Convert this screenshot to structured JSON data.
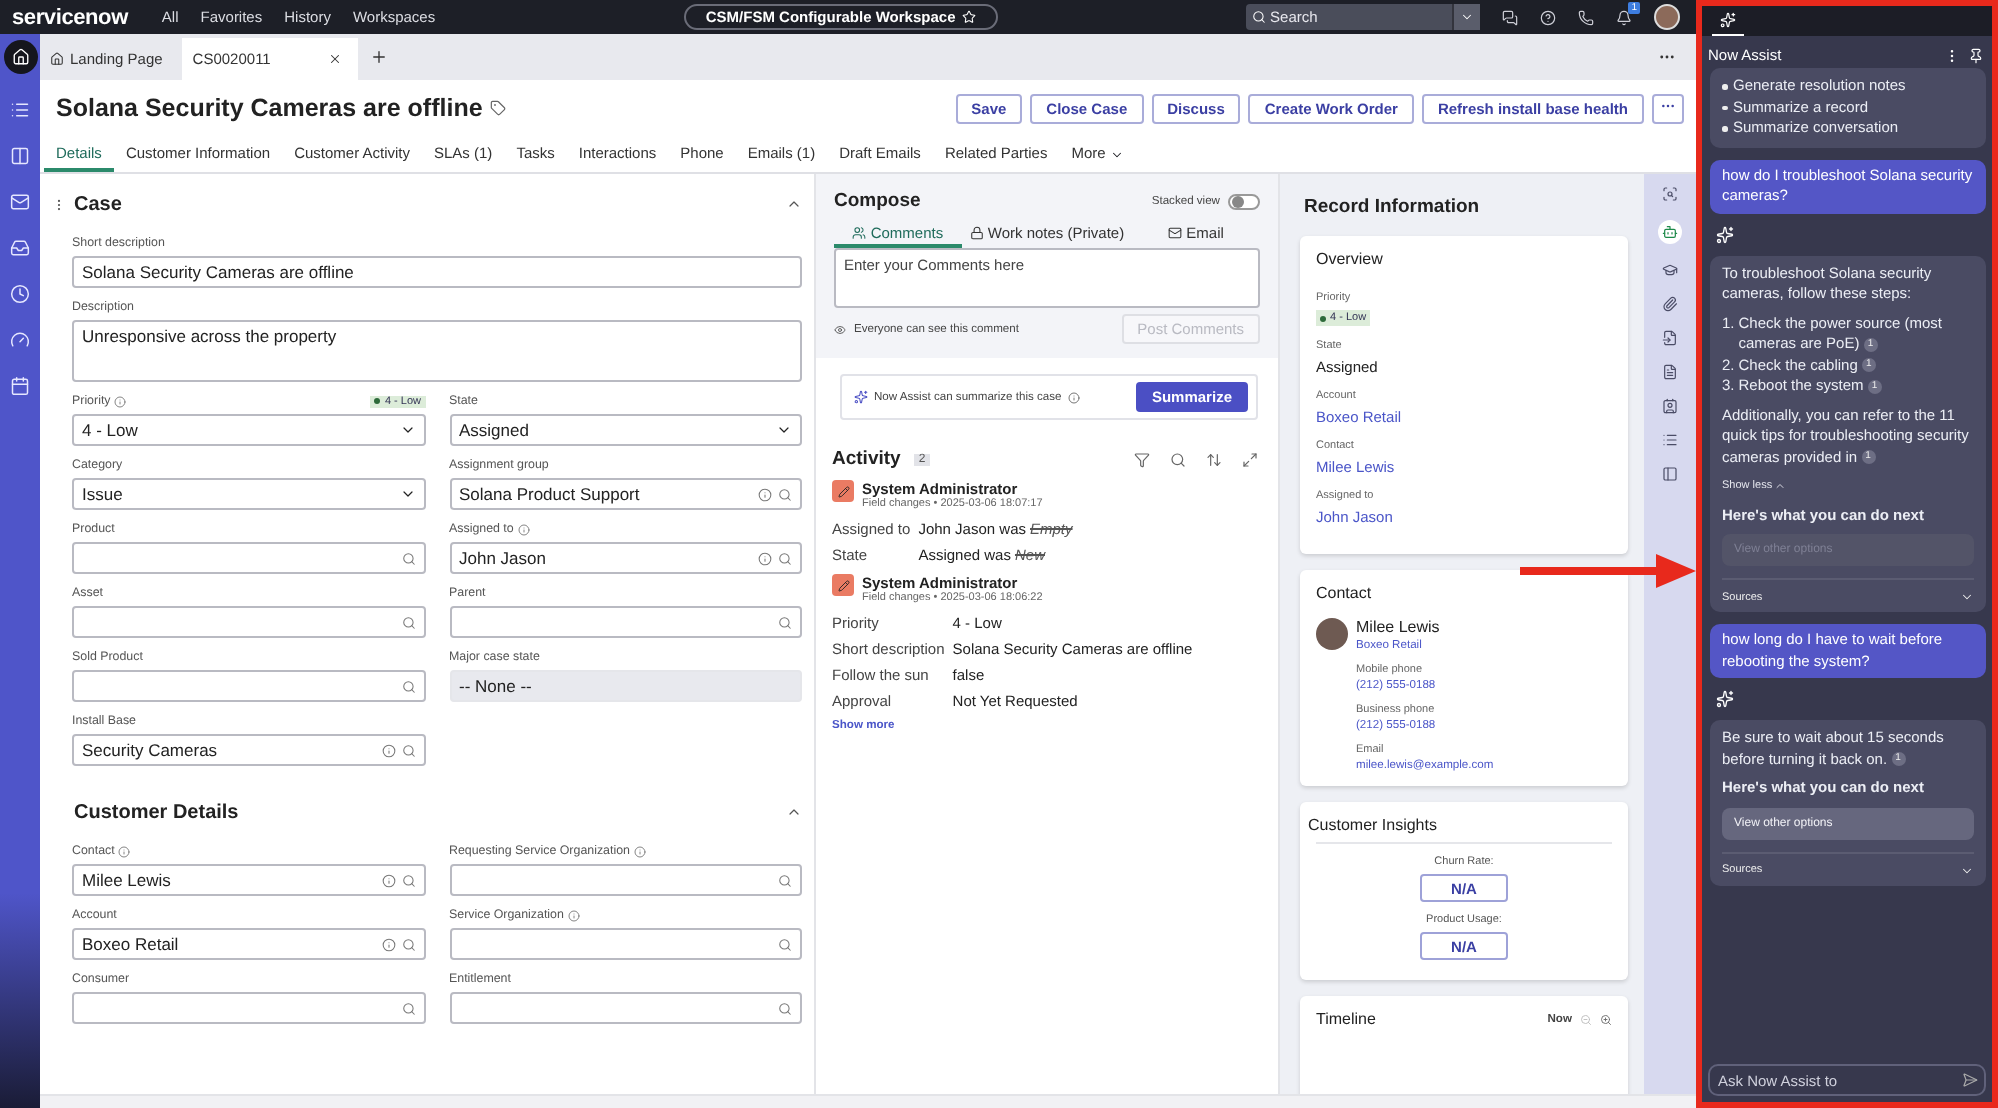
{
  "top_bar": {
    "logo": "servicenow",
    "nav": [
      "All",
      "Favorites",
      "History",
      "Workspaces"
    ],
    "workspace": "CSM/FSM Configurable Workspace",
    "search": {
      "placeholder": "Search"
    },
    "notification_count": "1"
  },
  "tabs": [
    {
      "label": "Landing Page",
      "kind": "home",
      "selected": false
    },
    {
      "label": "CS0020011",
      "kind": "record",
      "selected": true
    }
  ],
  "record": {
    "title": "Solana Security Cameras are offline",
    "actions": [
      "Save",
      "Close Case",
      "Discuss",
      "Create Work Order",
      "Refresh install base health"
    ]
  },
  "record_tabs": [
    {
      "label": "Details",
      "selected": true
    },
    {
      "label": "Customer Information",
      "selected": false
    },
    {
      "label": "Customer Activity",
      "selected": false
    },
    {
      "label": "SLAs (1)",
      "selected": false
    },
    {
      "label": "Tasks",
      "selected": false
    },
    {
      "label": "Interactions",
      "selected": false
    },
    {
      "label": "Phone",
      "selected": false
    },
    {
      "label": "Emails (1)",
      "selected": false
    },
    {
      "label": "Draft Emails",
      "selected": false
    },
    {
      "label": "Related Parties",
      "selected": false
    },
    {
      "label": "More",
      "selected": false,
      "kind": "menu"
    }
  ],
  "sections": [
    {
      "title": "Case",
      "expanded": true,
      "fields": [
        {
          "label": "Short description",
          "kind": "text",
          "value": "Solana Security Cameras are offline"
        },
        {
          "label": "Description",
          "kind": "textarea",
          "value": "Unresponsive across the property"
        },
        {
          "label": "Priority",
          "kind": "select",
          "value": "4 - Low",
          "info": true,
          "badge": "4 - Low"
        },
        {
          "label": "State",
          "kind": "select",
          "value": "Assigned"
        },
        {
          "label": "Category",
          "kind": "select",
          "value": "Issue"
        },
        {
          "label": "Assignment group",
          "kind": "lookup",
          "value": "Solana Product Support",
          "preview": true
        },
        {
          "label": "Product",
          "kind": "lookup"
        },
        {
          "label": "Assigned to",
          "kind": "lookup",
          "value": "John Jason",
          "info": true,
          "preview": true
        },
        {
          "label": "Asset",
          "kind": "lookup"
        },
        {
          "label": "Parent",
          "kind": "lookup"
        },
        {
          "label": "Sold Product",
          "kind": "lookup"
        },
        {
          "label": "Major case state",
          "kind": "readonly",
          "value": "-- None --"
        },
        {
          "label": "Install Base",
          "kind": "lookup",
          "value": "Security Cameras",
          "preview": true
        }
      ]
    },
    {
      "title": "Customer Details",
      "expanded": true,
      "fields": [
        {
          "label": "Contact",
          "kind": "lookup",
          "value": "Milee Lewis",
          "info": true,
          "preview": true
        },
        {
          "label": "Requesting Service Organization",
          "kind": "lookup",
          "info": true
        },
        {
          "label": "Account",
          "kind": "lookup",
          "value": "Boxeo Retail",
          "preview": true
        },
        {
          "label": "Service Organization",
          "kind": "lookup",
          "info": true
        },
        {
          "label": "Consumer",
          "kind": "lookup"
        },
        {
          "label": "Entitlement",
          "kind": "lookup"
        }
      ]
    }
  ],
  "compose": {
    "title": "Compose",
    "stacked_view": {
      "label": "Stacked view",
      "on": false
    },
    "tabs": [
      {
        "label": "Comments",
        "kind": "comments",
        "selected": true
      },
      {
        "label": "Work notes (Private)",
        "kind": "notes",
        "selected": false
      },
      {
        "label": "Email",
        "kind": "email",
        "selected": false
      }
    ],
    "placeholder": "Enter your Comments here",
    "visibility_note": "Everyone can see this comment",
    "post_button": {
      "label": "Post Comments",
      "disabled": true
    }
  },
  "summarize": {
    "text": "Now Assist can summarize this case",
    "button": "Summarize"
  },
  "activity": {
    "title": "Activity",
    "count": "2",
    "entries": [
      {
        "author": "System Administrator",
        "meta": "Field changes • 2025-03-06 18:07:17",
        "changes": [
          {
            "field": "Assigned to",
            "value": "John Jason was",
            "old": "Empty"
          },
          {
            "field": "State",
            "value": "Assigned was",
            "old": "New"
          }
        ]
      },
      {
        "author": "System Administrator",
        "meta": "Field changes • 2025-03-06 18:06:22",
        "changes": [
          {
            "field": "Priority",
            "value": "4 - Low"
          },
          {
            "field": "Short description",
            "value": "Solana Security Cameras are offline"
          },
          {
            "field": "Follow the sun",
            "value": "false"
          },
          {
            "field": "Approval",
            "value": "Not Yet Requested"
          }
        ]
      }
    ],
    "show_more": "Show more"
  },
  "record_info": {
    "title": "Record Information",
    "overview": {
      "title": "Overview",
      "items": [
        {
          "label": "Priority",
          "value": "4 - Low",
          "kind": "badge"
        },
        {
          "label": "State",
          "value": "Assigned",
          "kind": "text"
        },
        {
          "label": "Account",
          "value": "Boxeo Retail",
          "kind": "link"
        },
        {
          "label": "Contact",
          "value": "Milee Lewis",
          "kind": "link"
        },
        {
          "label": "Assigned to",
          "value": "John Jason",
          "kind": "link"
        }
      ]
    },
    "contact": {
      "title": "Contact",
      "name": "Milee Lewis",
      "account": "Boxeo Retail",
      "details": [
        {
          "label": "Mobile phone",
          "value": "(212) 555-0188"
        },
        {
          "label": "Business phone",
          "value": "(212) 555-0188"
        },
        {
          "label": "Email",
          "value": "milee.lewis@example.com"
        }
      ]
    },
    "insights": {
      "title": "Customer Insights",
      "metrics": [
        {
          "label": "Churn Rate:",
          "value": "N/A"
        },
        {
          "label": "Product Usage:",
          "value": "N/A"
        }
      ]
    },
    "timeline": {
      "title": "Timeline",
      "now": "Now"
    }
  },
  "now_assist": {
    "title": "Now Assist",
    "chat": [
      {
        "kind": "list",
        "items": [
          "Generate resolution notes",
          "Summarize a record",
          "Summarize conversation"
        ]
      },
      {
        "kind": "user",
        "text": "how do I troubleshoot Solana security cameras?"
      },
      {
        "kind": "answer",
        "intro": "To troubleshoot Solana security cameras, follow these steps:",
        "steps": [
          {
            "number": "1.",
            "text": "Check the power source (most cameras are PoE)",
            "cite": "1"
          },
          {
            "number": "2.",
            "text": "Check the cabling",
            "cite": "1"
          },
          {
            "number": "3.",
            "text": "Reboot the system",
            "cite": "1"
          }
        ],
        "outro": "Additionally, you can refer to the 11 quick tips for troubleshooting security cameras provided in",
        "outro_cite": "1",
        "toggle": "Show less",
        "next_title": "Here's what you can do next",
        "option": {
          "label": "View other options",
          "disabled": true
        },
        "sources": "Sources"
      },
      {
        "kind": "user",
        "text": "how long do I have to wait before rebooting the system?"
      },
      {
        "kind": "answer",
        "intro": "Be sure to wait about 15 seconds before turning it back on.",
        "intro_cite": "1",
        "next_title": "Here's what you can do next",
        "option": {
          "label": "View other options",
          "disabled": false
        },
        "sources": "Sources"
      }
    ],
    "input": {
      "placeholder": "Ask Now Assist to"
    }
  }
}
